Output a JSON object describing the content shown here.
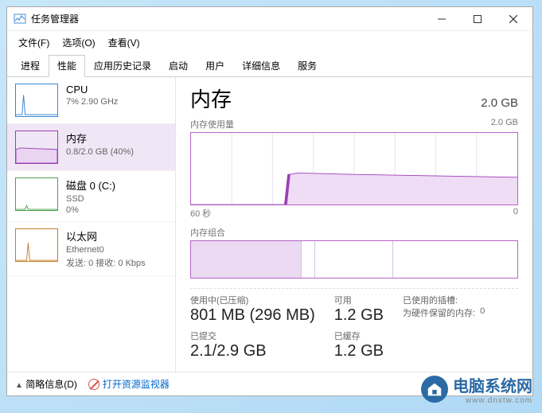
{
  "window": {
    "title": "任务管理器"
  },
  "menus": [
    "文件(F)",
    "选项(O)",
    "查看(V)"
  ],
  "tabs": [
    "进程",
    "性能",
    "应用历史记录",
    "启动",
    "用户",
    "详细信息",
    "服务"
  ],
  "active_tab": 1,
  "sidebar": {
    "items": [
      {
        "name": "CPU",
        "detail": "7% 2.90 GHz",
        "color": "#3a86d4",
        "selected": false
      },
      {
        "name": "内存",
        "detail": "0.8/2.0 GB (40%)",
        "color": "#9b3fb6",
        "selected": true
      },
      {
        "name": "磁盘 0 (C:)",
        "detail1": "SSD",
        "detail2": "0%",
        "color": "#4aa24a",
        "selected": false
      },
      {
        "name": "以太网",
        "detail1": "Ethernet0",
        "detail2": "发送: 0 接收: 0 Kbps",
        "color": "#c77d2a",
        "selected": false
      }
    ]
  },
  "main": {
    "heading": "内存",
    "total": "2.0 GB",
    "usage_label": "内存使用量",
    "usage_max": "2.0 GB",
    "x_left": "60 秒",
    "x_right": "0",
    "composition_label": "内存组合",
    "stats": {
      "in_use_label": "使用中(已压缩)",
      "in_use_value": "801 MB (296 MB)",
      "available_label": "可用",
      "available_value": "1.2 GB",
      "committed_label": "已提交",
      "committed_value": "2.1/2.9 GB",
      "cached_label": "已缓存",
      "cached_value": "1.2 GB",
      "slots_used_label": "已使用的插槽:",
      "slots_used_value": "",
      "hw_reserved_label": "为硬件保留的内存:",
      "hw_reserved_value": "0"
    }
  },
  "footer": {
    "less": "简略信息(D)",
    "resmon": "打开资源监视器"
  },
  "watermark": {
    "text": "电脑系统网",
    "url": "www.dnxtw.com"
  },
  "chart_data": {
    "type": "area",
    "title": "内存使用量",
    "xlabel": "秒",
    "ylabel": "GB",
    "x": [
      60,
      55,
      50,
      45,
      42,
      41,
      40,
      35,
      30,
      25,
      20,
      15,
      10,
      5,
      0
    ],
    "values": [
      0,
      0,
      0,
      0,
      0,
      0.8,
      0.82,
      0.81,
      0.79,
      0.78,
      0.78,
      0.77,
      0.77,
      0.77,
      0.77
    ],
    "ylim": [
      0,
      2.0
    ],
    "xlim": [
      60,
      0
    ],
    "series_color": "#9b3fb6"
  }
}
